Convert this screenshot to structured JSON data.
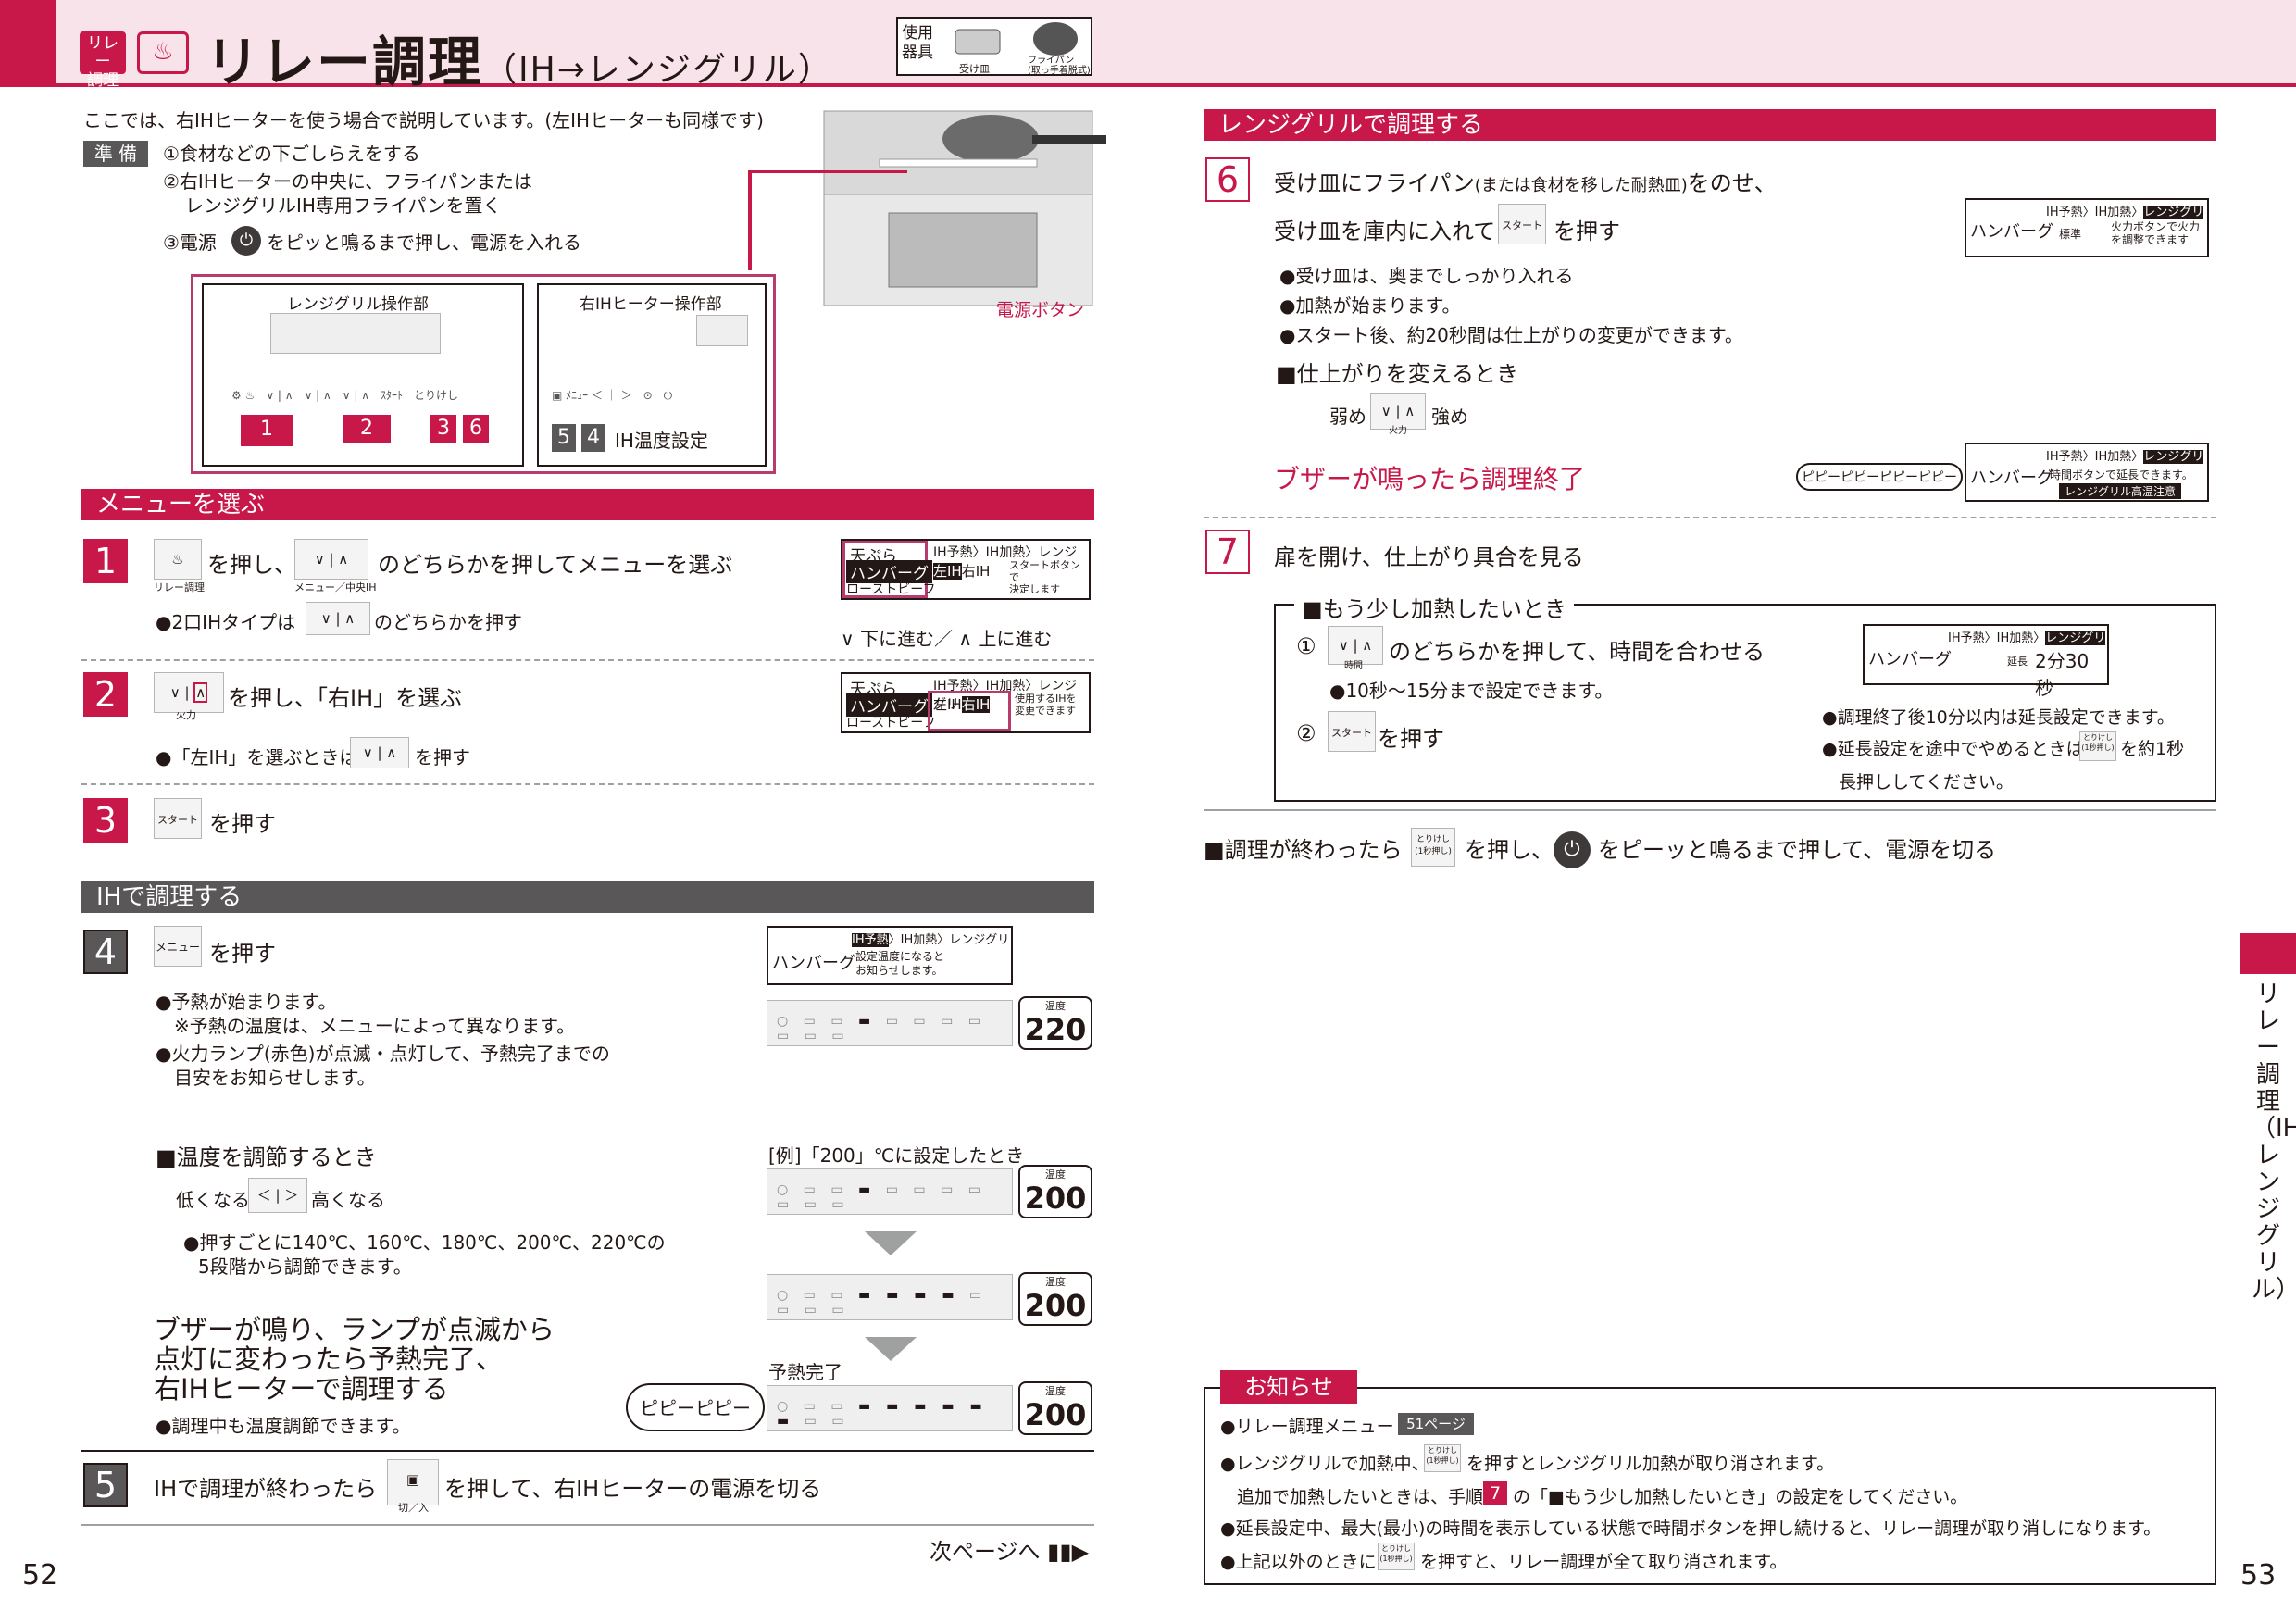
{
  "header": {
    "badge": "リレー\n調理",
    "title": "リレー調理",
    "title_sub": "（IH→レンジグリル）",
    "tools_label": "使用\n器具",
    "tool1": "受け皿",
    "tool2": "フライパン\n(取っ手着脱式)"
  },
  "left": {
    "intro": "ここでは、右IHヒーターを使う場合で説明しています。(左IHヒーターも同様です)",
    "prep_tag": "準 備",
    "prep1": "①食材などの下ごしらえをする",
    "prep2a": "②右IHヒーターの中央に、フライパンまたは",
    "prep2b": "レンジグリルIH専用フライパンを置く",
    "prep3a": "③電源",
    "prep3b": "をピッと鳴るまで押し、電源を入れる",
    "panel_grill": "レンジグリル操作部",
    "panel_ih": "右IHヒーター操作部",
    "power_label": "電源ボタン",
    "ih_temp_setting": "IH温度設定",
    "panel_nums": [
      "1",
      "2",
      "3",
      "6",
      "5",
      "4"
    ],
    "sec_menu": "メニューを選ぶ",
    "s1_text_a": "を押し、",
    "s1_text_b": "のどちらかを押してメニューを選ぶ",
    "s1_note": "●2口IHタイプは",
    "s1_note_b": "のどちらかを押す",
    "s1_icon_label": "リレー調理",
    "s1_icon_label2": "メニュー／中央IH",
    "s1_icon_label3": "メニュー",
    "menu_items": [
      "天ぷら",
      "ハンバーグ",
      "ローストビーフ"
    ],
    "menu_tabs": [
      "IH予熱",
      "IH加熱",
      "レンジグリ"
    ],
    "menu_lr": [
      "左IH",
      "右IH"
    ],
    "s1_hint": "スタートボタンで\n決定します",
    "s1_nav": "下に進む／",
    "s1_nav2": "上に進む",
    "s2_text": "を押し、「右IH」を選ぶ",
    "s2_note_a": "●「左IH」を選ぶときは",
    "s2_note_b": "を押す",
    "s2_hint": "使用するIHを\n変更できます",
    "firepower": "火力",
    "s3_text": "を押す",
    "start_label": "スタート",
    "sec_ih": "IHで調理する",
    "s4_text": "を押す",
    "menu_label": "メニュー",
    "s4_b1": "●予熱が始まります。",
    "s4_b1b": "※予熱の温度は、メニューによって異なります。",
    "s4_b2": "●火力ランプ(赤色)が点滅・点灯して、予熱完了までの",
    "s4_b2b": "目安をお知らせします。",
    "s4_panel_name": "ハンバーグ",
    "s4_panel_msg": "設定温度になると\nお知らせします。",
    "temp_label": "温度",
    "temp1": "220",
    "temp2": "200",
    "temp3": "200",
    "temp4": "200",
    "temp_unit": "℃",
    "adjust_title": "■温度を調節するとき",
    "adjust_low": "低くなる",
    "adjust_high": "高くなる",
    "adjust_note_a": "●押すごとに140℃、160℃、180℃、200℃、220℃の",
    "adjust_note_b": "5段階から調節できます。",
    "example": "[例]「200」℃に設定したとき",
    "preheat_done": "予熱完了",
    "buzzer_a": "ブザーが鳴り、ランプが点滅から",
    "buzzer_b": "点灯に変わったら予熱完了、",
    "buzzer_c": "右IHヒーターで調理する",
    "buzzer_note": "●調理中も温度調節できます。",
    "pipi": "ピピーピピー",
    "s5_text_a": "IHで調理が終わったら",
    "s5_text_b": "を押して、右IHヒーターの電源を切る",
    "onoff_label": "切／入",
    "next_page": "次ページへ",
    "page_no": "52"
  },
  "right": {
    "sec_grill": "レンジグリルで調理する",
    "s6_a": "受け皿にフライパン",
    "s6_a_small": "(または食材を移した耐熱皿)",
    "s6_a_end": "をのせ、",
    "s6_b": "受け皿を庫内に入れて",
    "s6_b_end": "を押す",
    "s6_n1": "●受け皿は、奥までしっかり入れる",
    "s6_n2": "●加熱が始まります。",
    "s6_n3": "●スタート後、約20秒間は仕上がりの変更ができます。",
    "finish_title": "■仕上がりを変えるとき",
    "weak": "弱め",
    "strong": "強め",
    "s6_panel_name": "ハンバーグ",
    "s6_panel_std": "標準",
    "s6_panel_msg": "火力ボタンで火力\nを調整できます",
    "buzzer_end": "ブザーが鳴ったら調理終了",
    "pipipi": "ピピーピピーピピーピピー",
    "end_panel_msg": "時間ボタンで延長できます。",
    "end_panel_warn": "レンジグリル高温注意",
    "s7_text": "扉を開け、仕上がり具合を見る",
    "more_title": "■もう少し加熱したいとき",
    "more1": "①",
    "more1_text": "のどちらかを押して、時間を合わせる",
    "time_label": "時間",
    "more1_note": "●10秒～15分まで設定できます。",
    "more2": "②",
    "more2_text": "を押す",
    "ext_label": "延長",
    "ext_time": "2分30秒",
    "more_note1": "●調理終了後10分以内は延長設定できます。",
    "more_note2a": "●延長設定を途中でやめるときは",
    "more_note2b": "を約1秒",
    "more_note2c": "長押ししてください。",
    "cancel_label": "とりけし\n(1秒押し)",
    "end_a": "■調理が終わったら",
    "end_b": "を押し、",
    "end_c": "をピーッと鳴るまで押して、電源を切る",
    "notice_title": "お知らせ",
    "n1": "●リレー調理メニュー",
    "n1_ref": "51ページ",
    "n2a": "●レンジグリルで加熱中、",
    "n2b": "を押すとレンジグリル加熱が取り消されます。",
    "n3a": "追加で加熱したいときは、手順",
    "n3_step": "7",
    "n3b": "の「■もう少し加熱したいとき」の設定をしてください。",
    "n4": "●延長設定中、最大(最小)の時間を表示している状態で時間ボタンを押し続けると、リレー調理が取り消しになります。",
    "n5a": "●上記以外のときに",
    "n5b": "を押すと、リレー調理が全て取り消されます。",
    "page_no": "53",
    "side_text": "リレー調理（IH→レンジグリル）"
  },
  "colors": {
    "accent": "#c8184a",
    "gray": "#595757",
    "pink_bg": "#f8e3ea"
  }
}
